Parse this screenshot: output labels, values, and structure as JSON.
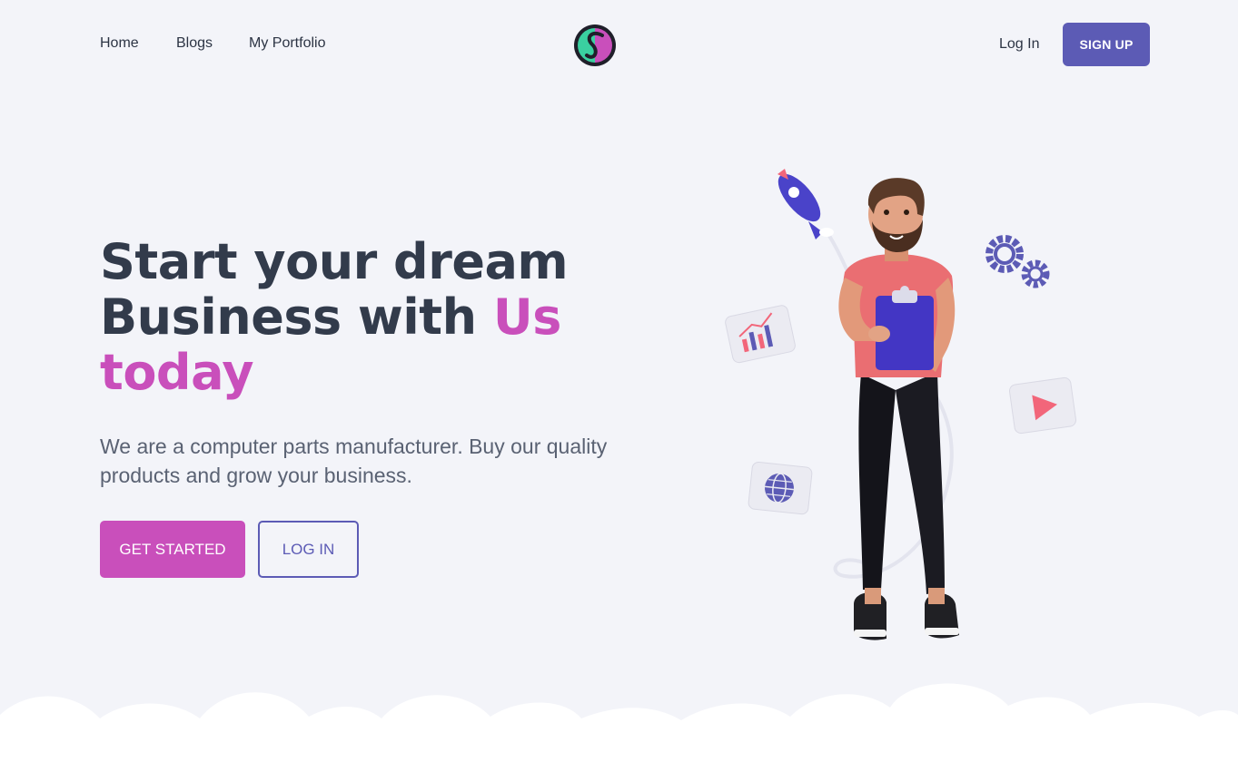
{
  "nav": {
    "links": [
      "Home",
      "Blogs",
      "My Portfolio"
    ],
    "login_label": "Log In",
    "signup_label": "SIGN UP"
  },
  "hero": {
    "title_line1": "Start your dream",
    "title_line2_a": "Business with ",
    "title_line2_b": "Us",
    "title_line3": "today",
    "subtitle": "We are a computer parts manufacturer. Buy our quality products and grow your business.",
    "cta_primary": "GET STARTED",
    "cta_secondary": "LOG IN"
  },
  "colors": {
    "background": "#f3f4f9",
    "brand_purple": "#5c5bb5",
    "accent_pink": "#c94fbb",
    "heading": "#323b4b"
  },
  "icons": [
    "logo-icon",
    "rocket-icon",
    "gears-icon",
    "chart-icon",
    "play-icon",
    "globe-icon"
  ]
}
